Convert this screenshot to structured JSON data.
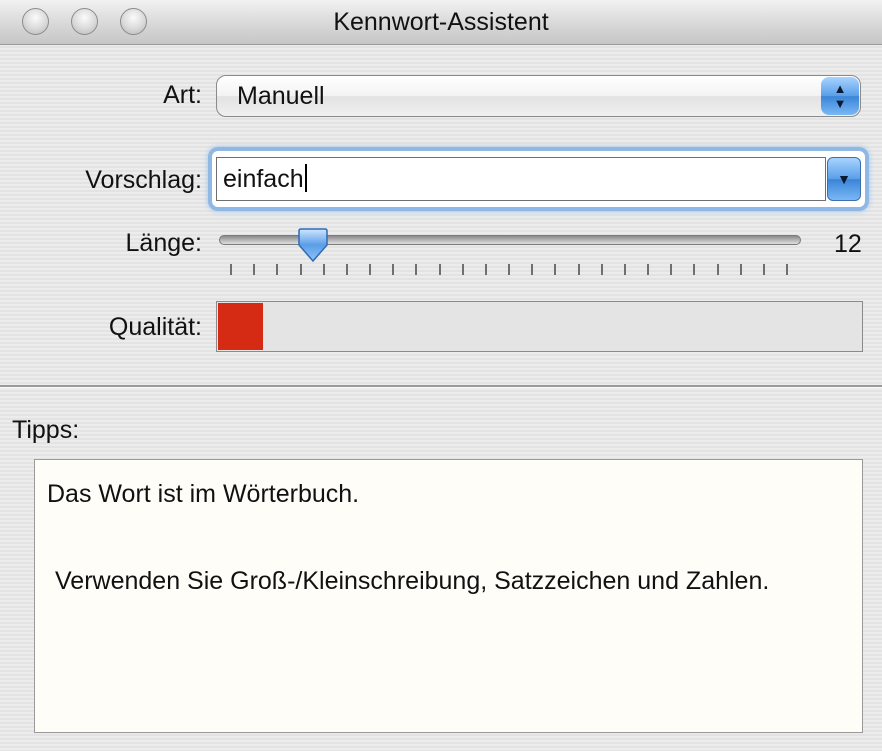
{
  "window": {
    "title": "Kennwort-Assistent"
  },
  "form": {
    "type_label": "Art:",
    "type_value": "Manuell",
    "suggestion_label": "Vorschlag:",
    "suggestion_value": "einfach",
    "length_label": "Länge:",
    "length_value": "12",
    "length_fraction": 0.14,
    "quality_label": "Qualität:",
    "quality_fraction": 0.07,
    "quality_color": "#d52a14"
  },
  "tips": {
    "label": "Tipps:",
    "lines": [
      "Das Wort ist im Wörterbuch.",
      "Verwenden Sie Groß-/Kleinschreibung, Satzzeichen und Zahlen."
    ]
  },
  "colors": {
    "accent": "#5a9ee8",
    "focus_ring": "#8fb8e4"
  }
}
